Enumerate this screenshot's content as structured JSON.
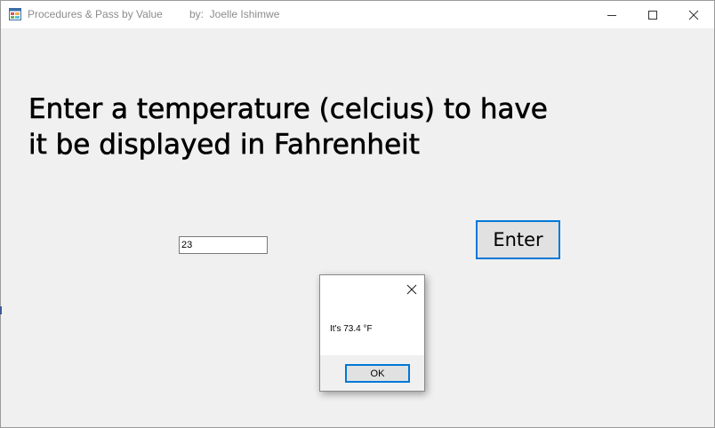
{
  "window": {
    "title": "Procedures & Pass by Value",
    "author": "by:  Joelle Ishimwe",
    "icon": "windows-forms-app-icon"
  },
  "main": {
    "headline_line1": "Enter a temperature (celcius) to have",
    "headline_line2": "it be displayed in Fahrenheit",
    "temperature_value": "23",
    "enter_label": "Enter"
  },
  "dialog": {
    "message": "It's 73.4 °F",
    "ok_label": "OK"
  },
  "colors": {
    "accent": "#0078d7",
    "form_background": "#f0f0f0"
  }
}
